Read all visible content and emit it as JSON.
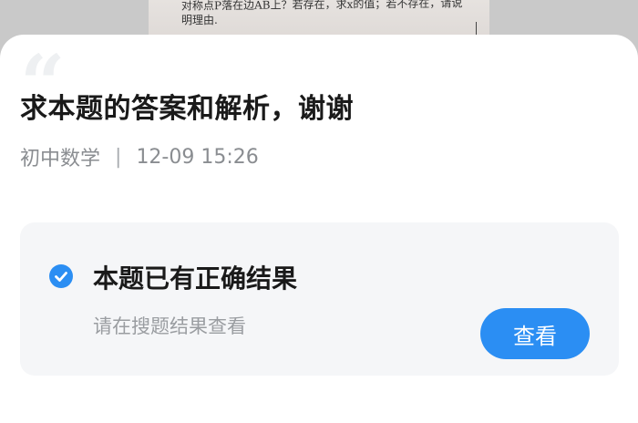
{
  "backdrop": {
    "line1": "对称点P落在边AB上？若存在，求x的值；若不存在，请说",
    "line2": "明理由."
  },
  "question": {
    "quote_mark": "“",
    "title": "求本题的答案和解析，谢谢",
    "subject": "初中数学",
    "separator": "|",
    "datetime": "12-09 15:26"
  },
  "result_card": {
    "icon": "check-circle-icon",
    "title": "本题已有正确结果",
    "subtitle": "请在搜题结果查看",
    "button_label": "查看"
  },
  "colors": {
    "accent": "#2b8ef3",
    "card_bg": "#f5f6f8",
    "title_text": "#1a1a1a",
    "meta_text": "#8a8d91"
  }
}
